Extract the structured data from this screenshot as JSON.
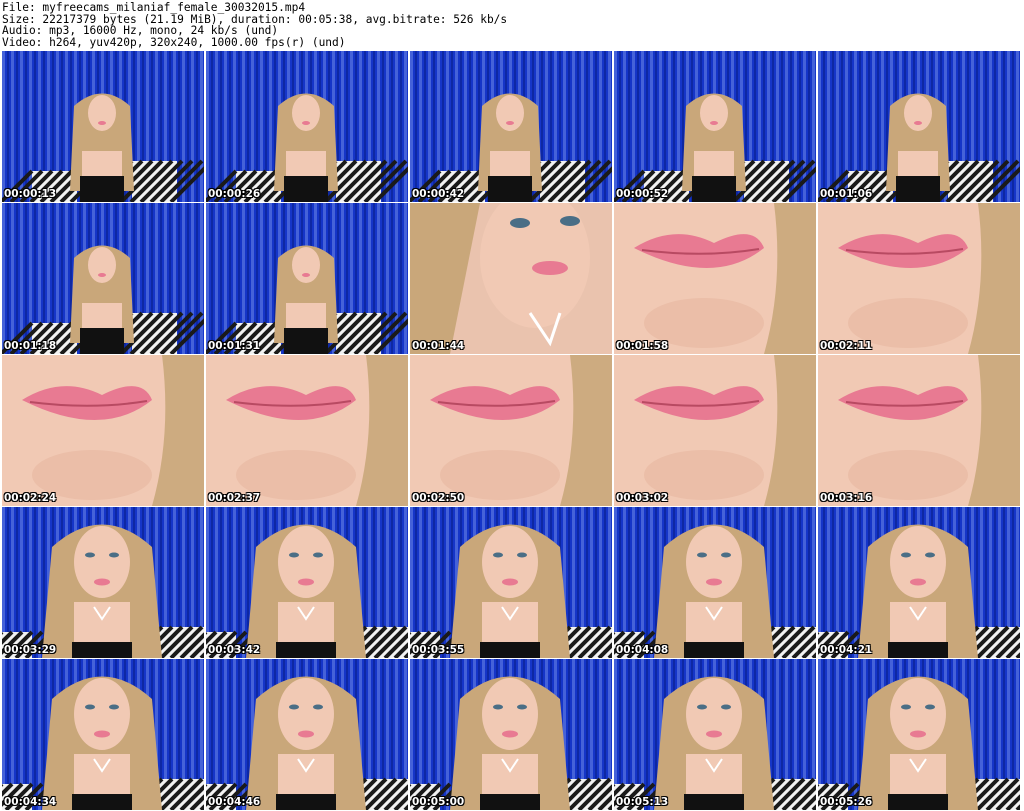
{
  "header": {
    "line1": "File: myfreecams_milaniaf_female_30032015.mp4",
    "line2": "Size: 22217379 bytes (21.19 MiB), duration: 00:05:38, avg.bitrate: 526 kb/s",
    "line3": "Audio: mp3, 16000 Hz, mono, 24 kb/s (und)",
    "line4": "Video: h264, yuv420p, 320x240, 1000.00 fps(r) (und)"
  },
  "thumbnails": [
    {
      "timestamp": "00:00:13",
      "scene": "wide"
    },
    {
      "timestamp": "00:00:26",
      "scene": "wide"
    },
    {
      "timestamp": "00:00:42",
      "scene": "wide"
    },
    {
      "timestamp": "00:00:52",
      "scene": "wide"
    },
    {
      "timestamp": "00:01:06",
      "scene": "wide"
    },
    {
      "timestamp": "00:01:18",
      "scene": "wide"
    },
    {
      "timestamp": "00:01:31",
      "scene": "wide"
    },
    {
      "timestamp": "00:01:44",
      "scene": "face"
    },
    {
      "timestamp": "00:01:58",
      "scene": "lips"
    },
    {
      "timestamp": "00:02:11",
      "scene": "lips"
    },
    {
      "timestamp": "00:02:24",
      "scene": "lips"
    },
    {
      "timestamp": "00:02:37",
      "scene": "lips"
    },
    {
      "timestamp": "00:02:50",
      "scene": "lips"
    },
    {
      "timestamp": "00:03:02",
      "scene": "lips"
    },
    {
      "timestamp": "00:03:16",
      "scene": "lips"
    },
    {
      "timestamp": "00:03:29",
      "scene": "close"
    },
    {
      "timestamp": "00:03:42",
      "scene": "close"
    },
    {
      "timestamp": "00:03:55",
      "scene": "close"
    },
    {
      "timestamp": "00:04:08",
      "scene": "close"
    },
    {
      "timestamp": "00:04:21",
      "scene": "close"
    },
    {
      "timestamp": "00:04:34",
      "scene": "close"
    },
    {
      "timestamp": "00:04:46",
      "scene": "close"
    },
    {
      "timestamp": "00:05:00",
      "scene": "close"
    },
    {
      "timestamp": "00:05:13",
      "scene": "close"
    },
    {
      "timestamp": "00:05:26",
      "scene": "close"
    }
  ],
  "colors": {
    "curtain_blue": "#1535c8",
    "curtain_light": "#6e86e8",
    "hair": "#c9a77a",
    "skin": "#f1c9b4",
    "lips": "#e87a92",
    "top_black": "#111111"
  }
}
